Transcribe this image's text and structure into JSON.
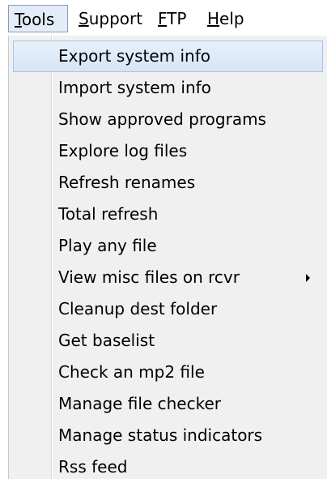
{
  "menubar": {
    "items": [
      {
        "mnemonic": "T",
        "rest": "ools",
        "active": true
      },
      {
        "mnemonic": "S",
        "rest": "upport",
        "active": false
      },
      {
        "mnemonic": "F",
        "rest": "TP",
        "active": false
      },
      {
        "mnemonic": "H",
        "rest": "elp",
        "active": false
      }
    ]
  },
  "tools_menu": {
    "items": [
      {
        "label": "Export system info",
        "highlighted": true
      },
      {
        "label": "Import system info"
      },
      {
        "label": "Show approved programs"
      },
      {
        "label": "Explore log files"
      },
      {
        "label": "Refresh renames"
      },
      {
        "label": "Total refresh"
      },
      {
        "label": "Play any file"
      },
      {
        "label": "View misc files on rcvr",
        "submenu": true
      },
      {
        "label": "Cleanup dest folder"
      },
      {
        "label": "Get baselist"
      },
      {
        "label": "Check an mp2 file"
      },
      {
        "label": "Manage file checker"
      },
      {
        "label": "Manage status indicators"
      },
      {
        "label": "Rss feed"
      }
    ]
  },
  "colors": {
    "menu_background": "#f0f0f0",
    "highlight_background": "#dde8f6",
    "highlight_border": "#a8c4e6",
    "active_menubar_border": "#8a9bb8"
  },
  "icons": {
    "submenu": "chevron-right-icon"
  }
}
